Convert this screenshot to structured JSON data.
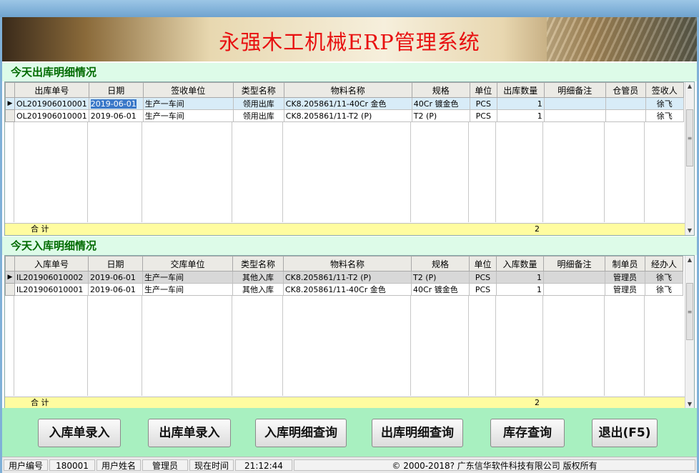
{
  "banner": {
    "title": "永强木工机械ERP管理系统"
  },
  "outbound": {
    "heading": "今天出库明细情况",
    "columns": [
      "出库单号",
      "日期",
      "签收单位",
      "类型名称",
      "物料名称",
      "规格",
      "单位",
      "出库数量",
      "明细备注",
      "仓管员",
      "签收人"
    ],
    "rows": [
      [
        "OL201906010001",
        "2019-06-01",
        "生产一车间",
        "领用出库",
        "CK8.205861/11-40Cr 金色",
        "40Cr 镀金色",
        "PCS",
        "1",
        "",
        "",
        "徐飞"
      ],
      [
        "OL201906010001",
        "2019-06-01",
        "生产一车间",
        "领用出库",
        "CK8.205861/11-T2 (P)",
        "T2 (P)",
        "PCS",
        "1",
        "",
        "",
        "徐飞"
      ]
    ],
    "total_label": "合 计",
    "total_qty": "2"
  },
  "inbound": {
    "heading": "今天入库明细情况",
    "columns": [
      "入库单号",
      "日期",
      "交库单位",
      "类型名称",
      "物料名称",
      "规格",
      "单位",
      "入库数量",
      "明细备注",
      "制单员",
      "经办人"
    ],
    "rows": [
      [
        "IL201906010002",
        "2019-06-01",
        "生产一车间",
        "其他入库",
        "CK8.205861/11-T2 (P)",
        "T2 (P)",
        "PCS",
        "1",
        "",
        "管理员",
        "徐飞"
      ],
      [
        "IL201906010001",
        "2019-06-01",
        "生产一车间",
        "其他入库",
        "CK8.205861/11-40Cr 金色",
        "40Cr 镀金色",
        "PCS",
        "1",
        "",
        "管理员",
        "徐飞"
      ]
    ],
    "total_label": "合 计",
    "total_qty": "2"
  },
  "buttons": {
    "inbound_entry": "入库单录入",
    "outbound_entry": "出库单录入",
    "inbound_query": "入库明细查询",
    "outbound_query": "出库明细查询",
    "stock_query": "库存查询",
    "exit": "退出(F5)"
  },
  "status": {
    "user_id_label": "用户编号",
    "user_id": "180001",
    "user_name_label": "用户姓名",
    "user_name": "管理员",
    "time_label": "现在时间",
    "time": "21:12:44",
    "copyright": "© 2000-2018? 广东信华软件科技有限公司 版权所有"
  }
}
